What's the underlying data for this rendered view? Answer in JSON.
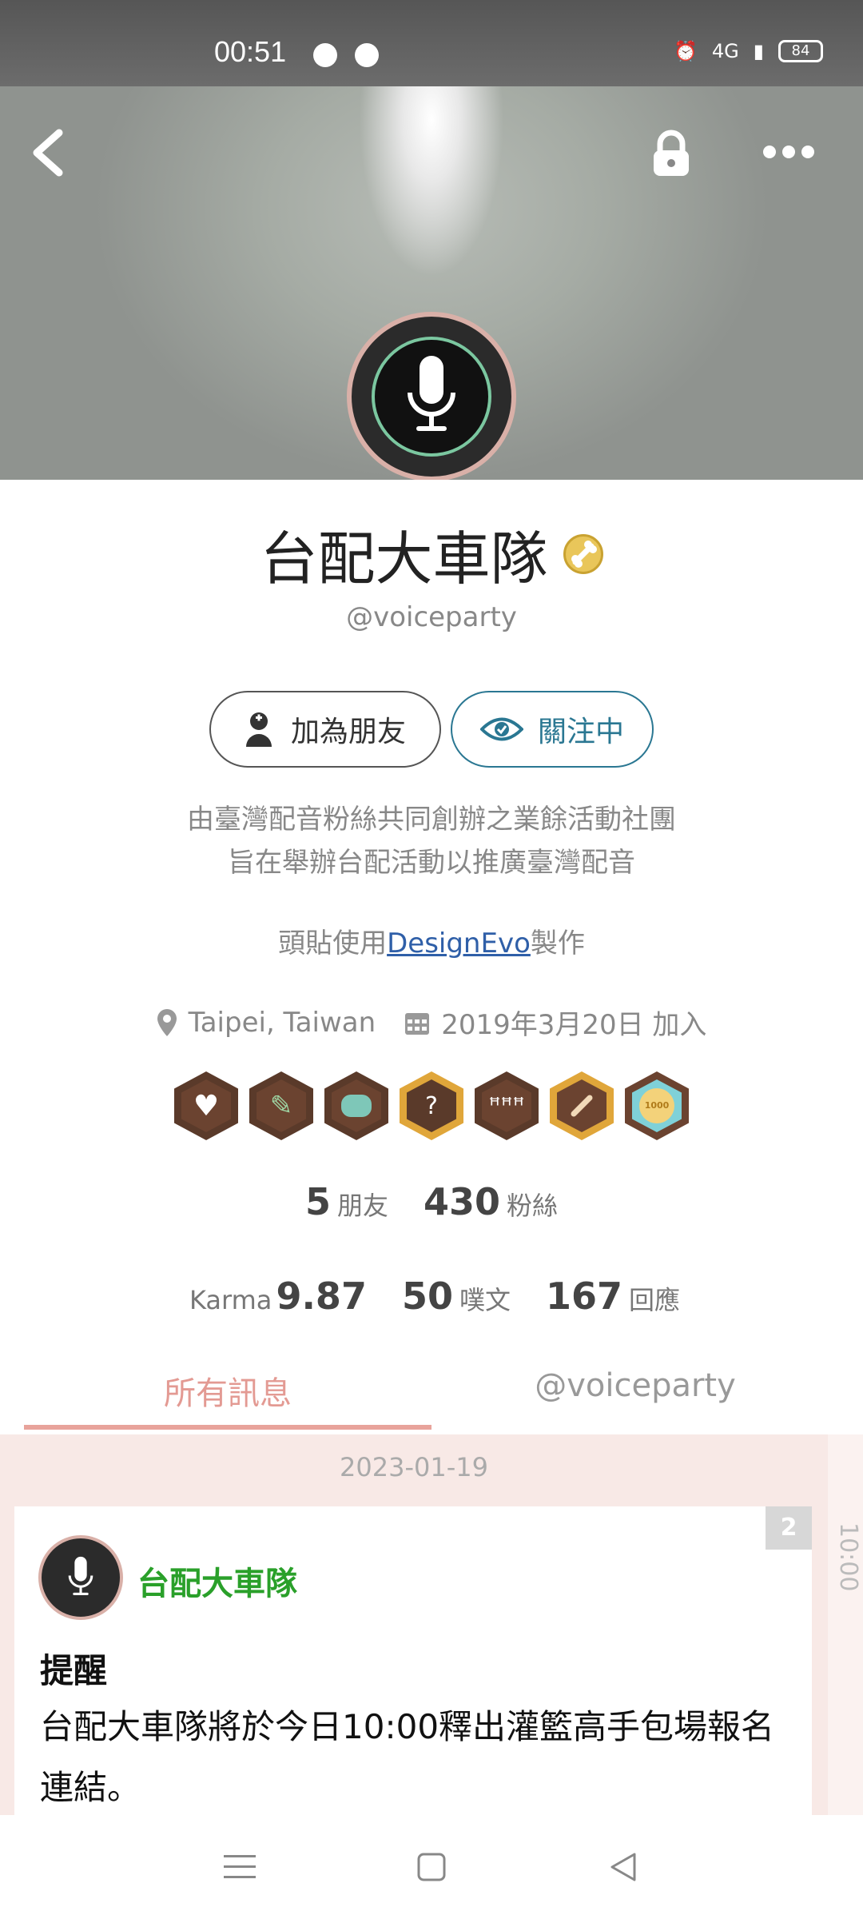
{
  "status_bar": {
    "time": "00:51",
    "network": "4G",
    "battery": "84"
  },
  "profile": {
    "name": "台配大車隊",
    "handle": "@voiceparty",
    "buttons": {
      "add_friend": "加為朋友",
      "following": "關注中"
    },
    "bio_line1": "由臺灣配音粉絲共同創辦之業餘活動社團",
    "bio_line2": "旨在舉辦台配活動以推廣臺灣配音",
    "credit_prefix": "頭貼使用",
    "credit_link": "DesignEvo",
    "credit_suffix": "製作",
    "location": "Taipei, Taiwan",
    "joined": "2019年3月20日 加入",
    "badges": [
      "heart-badge",
      "pencil-badge",
      "chat-badge",
      "question-badge",
      "group-badge",
      "bone-badge",
      "1000-badge"
    ],
    "badge_1000_text": "1000",
    "stats": {
      "friends_num": "5",
      "friends_label": "朋友",
      "fans_num": "430",
      "fans_label": "粉絲",
      "karma_label": "Karma",
      "karma_num": "9.87",
      "plurks_num": "50",
      "plurks_label": "噗文",
      "replies_num": "167",
      "replies_label": "回應"
    }
  },
  "tabs": {
    "all": "所有訊息",
    "handle": "@voiceparty"
  },
  "feed": {
    "date": "2023-01-19",
    "side_time": "10:00",
    "post": {
      "count": "2",
      "author": "台配大車隊",
      "title": "提醒",
      "body": "台配大車隊將於今日10:00釋出灌籃高手包場報名連結。"
    }
  },
  "colors": {
    "accent_tab": "#e39a93",
    "follow_blue": "#2a7792",
    "author_green": "#2aa02a",
    "link_blue": "#2f5fa8"
  }
}
